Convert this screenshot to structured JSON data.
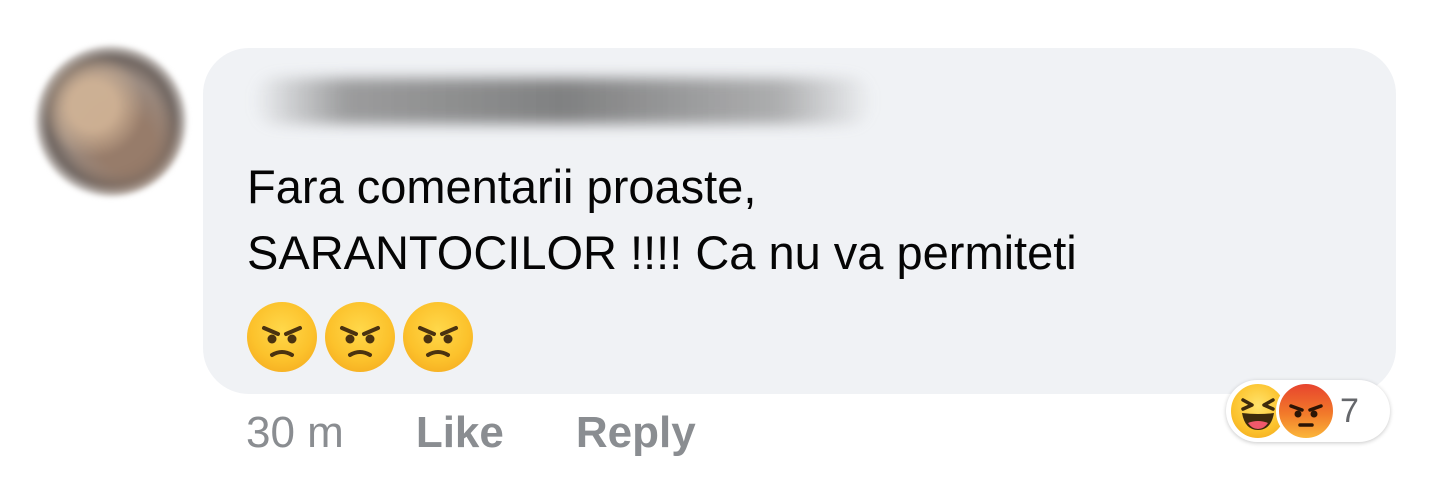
{
  "comment": {
    "text": "Fara comentarii proaste,\nSARANTOCILOR !!!! Ca nu va permiteti",
    "emojis": [
      "angry-face",
      "angry-face",
      "angry-face"
    ]
  },
  "meta": {
    "time": "30 m",
    "like_label": "Like",
    "reply_label": "Reply"
  },
  "reactions": {
    "icons": [
      "haha-reaction",
      "angry-reaction"
    ],
    "count": "7"
  },
  "colors": {
    "bubble": "#f0f2f5",
    "meta_text": "#8a8d91",
    "comment_text": "#050505"
  }
}
